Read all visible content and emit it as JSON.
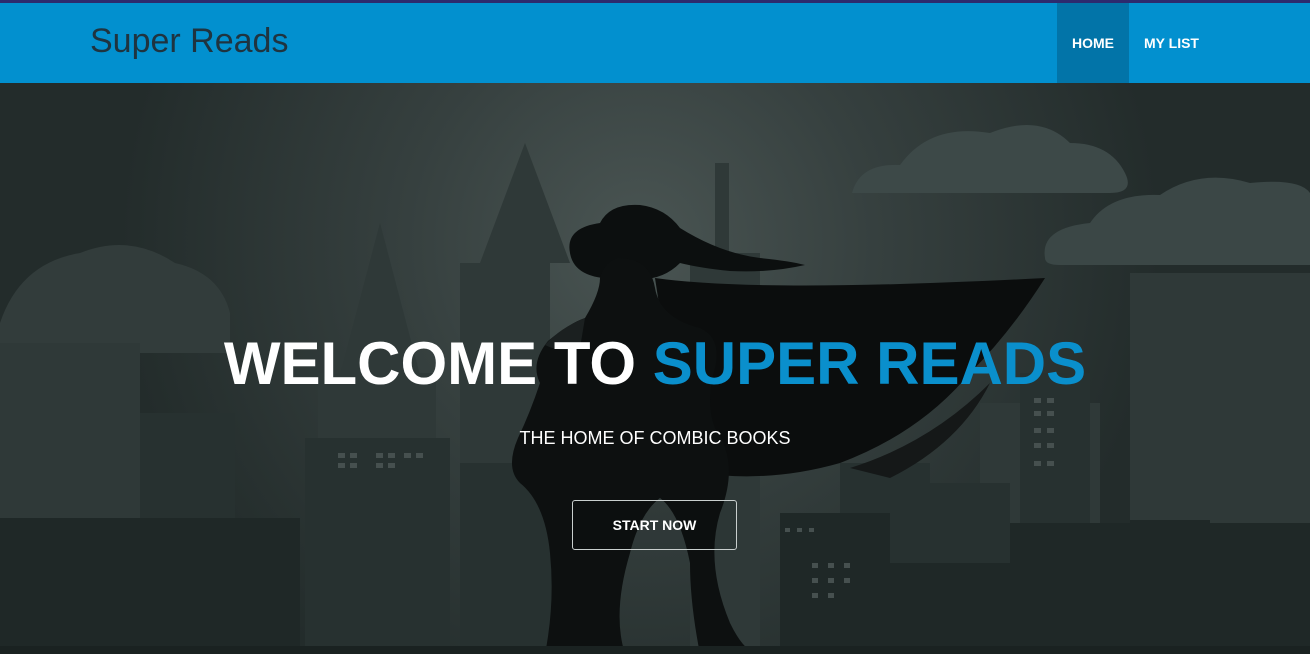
{
  "navbar": {
    "brand": "Super Reads",
    "items": [
      {
        "label": "HOME",
        "active": true
      },
      {
        "label": "MY LIST",
        "active": false
      }
    ],
    "color": "#0290cf",
    "active_color": "#0274a8"
  },
  "hero": {
    "headline_prefix": "WELCOME TO ",
    "headline_accent": "SUPER READS",
    "subtitle": "THE HOME OF COMBIC BOOKS",
    "cta_label": "START NOW",
    "accent_color": "#0a8fcc",
    "background_image": "superhero-woman-cityscape-silhouette"
  }
}
